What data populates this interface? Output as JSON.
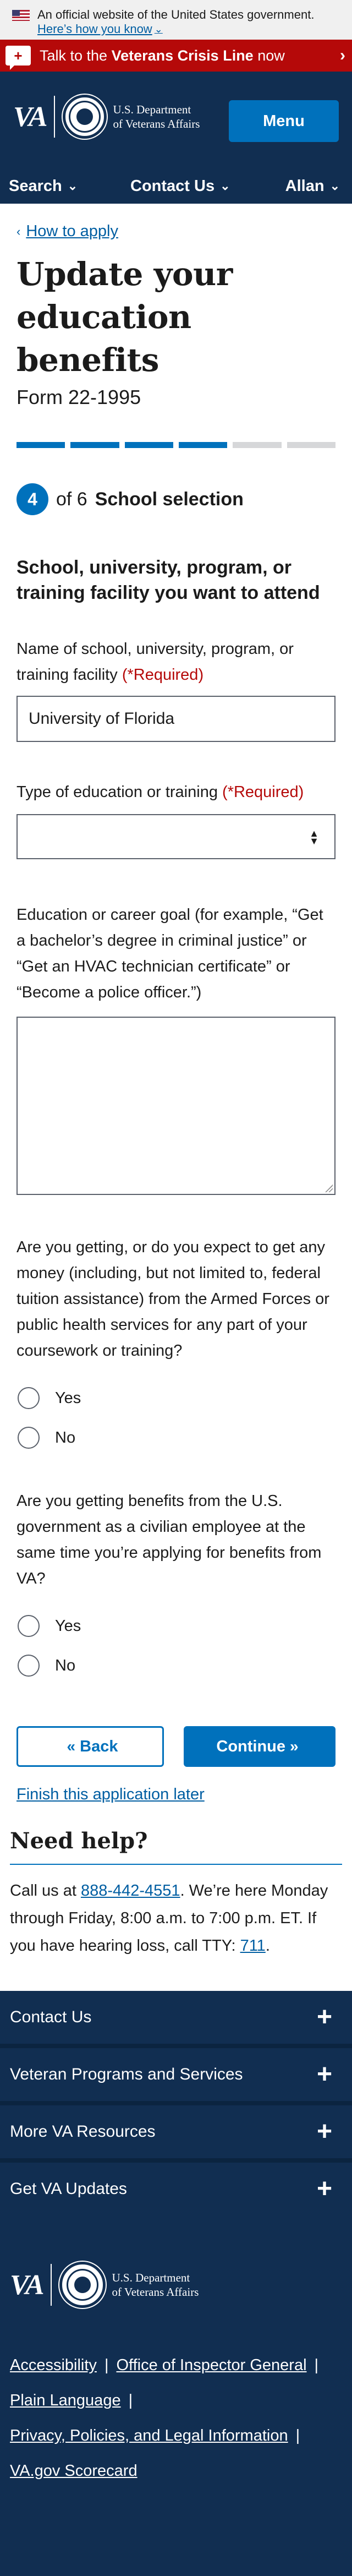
{
  "official_banner": {
    "text": "An official website of the United States government.",
    "link": "Here’s how you know"
  },
  "crisis_line": {
    "prefix": "Talk to the ",
    "bold": "Veterans Crisis Line",
    "suffix": " now"
  },
  "header": {
    "logo": "VA",
    "dept_line1": "U.S. Department",
    "dept_line2": "of Veterans Affairs",
    "menu_label": "Menu",
    "nav": {
      "search": "Search",
      "contact": "Contact Us",
      "user": "Allan"
    }
  },
  "main": {
    "back_link": "How to apply",
    "title": "Update your education benefits",
    "form_number": "Form 22-1995",
    "progress": {
      "total_steps": 6,
      "completed_steps": 4
    },
    "step": {
      "current": "4",
      "of_text": "of 6",
      "name": "School selection"
    }
  },
  "form": {
    "section_title": "School, university, program, or training facility you want to attend",
    "school_name": {
      "label": "Name of school, university, program, or training facility",
      "required": "(*Required)",
      "value": "University of Florida"
    },
    "education_type": {
      "label": "Type of education or training",
      "required": "(*Required)",
      "value": ""
    },
    "career_goal": {
      "label": "Education or career goal (for example, “Get a bachelor’s degree in criminal justice” or “Get an HVAC technician certificate” or “Become a police officer.”)",
      "value": ""
    },
    "question_funding": {
      "label": "Are you getting, or do you expect to get any money (including, but not limited to, federal tuition assistance) from the Armed Forces or public health services for any part of your coursework or training?",
      "options": [
        "Yes",
        "No"
      ]
    },
    "question_civilian": {
      "label": "Are you getting benefits from the U.S. government as a civilian employee at the same time you’re applying for benefits from VA?",
      "options": [
        "Yes",
        "No"
      ]
    },
    "buttons": {
      "back": "Back",
      "continue": "Continue"
    },
    "finish_later": "Finish this application later"
  },
  "help": {
    "title": "Need help?",
    "text_1": "Call us at ",
    "phone": "888-442-4551",
    "text_2": ". We’re here Monday through Friday, 8:00 a.m. to 7:00 p.m. ET. If you have hearing loss, call TTY: ",
    "tty": "711",
    "text_3": "."
  },
  "footer": {
    "accordion": [
      "Contact Us",
      "Veteran Programs and Services",
      "More VA Resources",
      "Get VA Updates"
    ],
    "links": {
      "accessibility": "Accessibility",
      "inspector_general": "Office of Inspector General",
      "plain_language": "Plain Language",
      "privacy": "Privacy, Policies, and Legal Information",
      "scorecard": "VA.gov Scorecard"
    }
  },
  "colors": {
    "primary": "#0071bc",
    "navy": "#112e51",
    "crisis_red": "#b50909",
    "link": "#005ea2"
  }
}
